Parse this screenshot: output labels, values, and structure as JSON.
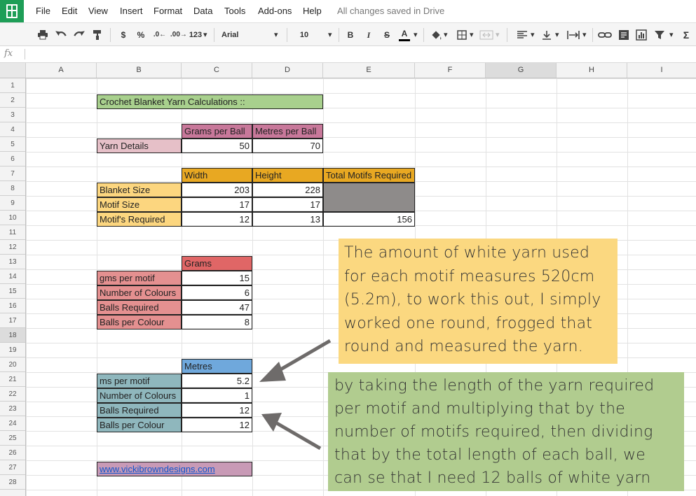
{
  "app": {
    "saved_status": "All changes saved in Drive"
  },
  "menu": [
    "File",
    "Edit",
    "View",
    "Insert",
    "Format",
    "Data",
    "Tools",
    "Add-ons",
    "Help"
  ],
  "toolbar": {
    "currency": "$",
    "percent": "%",
    "decrease_decimals": ".0←",
    "increase_decimals": ".00→",
    "number_format": "123",
    "font_name": "Arial",
    "font_size": "10",
    "bold": "B",
    "italic": "I",
    "strike": "S",
    "text_color": "A",
    "functions": "Σ"
  },
  "formula_bar": {
    "label": "fx",
    "value": ""
  },
  "columns": [
    "A",
    "B",
    "C",
    "D",
    "E",
    "F",
    "G",
    "H",
    "I"
  ],
  "selected_column": "G",
  "rows": [
    "1",
    "2",
    "3",
    "4",
    "5",
    "6",
    "7",
    "8",
    "9",
    "10",
    "11",
    "12",
    "13",
    "14",
    "15",
    "16",
    "17",
    "18",
    "19",
    "20",
    "21",
    "22",
    "23",
    "24",
    "25",
    "26",
    "27",
    "28"
  ],
  "selected_row": "18",
  "sheet": {
    "title": "Crochet Blanket Yarn Calculations ::",
    "yarn": {
      "h_grams": "Grams per Ball",
      "h_metres": "Metres per Ball",
      "label": "Yarn Details",
      "grams": "50",
      "metres": "70"
    },
    "size": {
      "h_width": "Width",
      "h_height": "Height",
      "h_total": "Total Motifs Required",
      "blanket_label": "Blanket Size",
      "blanket_w": "203",
      "blanket_h": "228",
      "motif_label": "Motif Size",
      "motif_w": "17",
      "motif_h": "17",
      "req_label": "Motif's Required",
      "req_w": "12",
      "req_h": "13",
      "total": "156"
    },
    "grams": {
      "header": "Grams",
      "r1_label": "gms per motif",
      "r1_val": "15",
      "r2_label": "Number of Colours",
      "r2_val": "6",
      "r3_label": "Balls Required",
      "r3_val": "47",
      "r4_label": "Balls per Colour",
      "r4_val": "8"
    },
    "metres": {
      "header": "Metres",
      "r1_label": "ms per motif",
      "r1_val": "5.2",
      "r2_label": "Number of Colours",
      "r2_val": "1",
      "r3_label": "Balls Required",
      "r3_val": "12",
      "r4_label": "Balls per Colour",
      "r4_val": "12"
    },
    "link": "www.vickibrowndesigns.com"
  },
  "notes": {
    "note1": "The amount of white yarn used for each motif measures 520cm (5.2m), to work this out, I simply worked one round, frogged that round and measured the yarn.",
    "note2": "by taking the length of the yarn required per motif and multiplying that by the number of motifs required, then dividing that by the total length of each ball, we can se that I need 12 balls of white yarn"
  },
  "colors": {
    "green_title": "#a8d08d",
    "pink_header": "#c8789a",
    "pink_light": "#e6c0c8",
    "orange_header": "#e8a822",
    "yellow_label": "#fcd67f",
    "grey_fill": "#8e8b8a",
    "red_header": "#e06666",
    "red_label": "#e49090",
    "blue_header": "#6fa8dc",
    "teal_label": "#8fb7bd",
    "link_fill": "#c89ab6",
    "note_yellow": "#fbd880",
    "note_green": "#b1cc8f",
    "brand_green": "#1e9e57"
  }
}
